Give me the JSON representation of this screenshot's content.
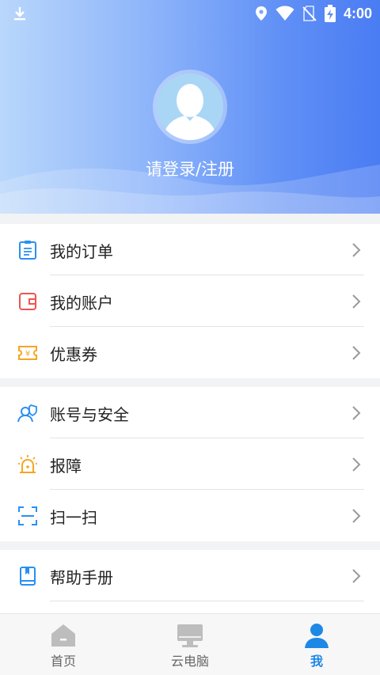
{
  "status_bar": {
    "time": "4:00"
  },
  "profile": {
    "login_label": "请登录/注册"
  },
  "menu_groups": [
    {
      "items": [
        {
          "label": "我的订单",
          "icon": "order-list-icon",
          "color": "#2a8ff2"
        },
        {
          "label": "我的账户",
          "icon": "wallet-icon",
          "color": "#ef5350"
        },
        {
          "label": "优惠券",
          "icon": "coupon-icon",
          "color": "#f5a623"
        }
      ]
    },
    {
      "items": [
        {
          "label": "账号与安全",
          "icon": "account-security-icon",
          "color": "#2a8ff2"
        },
        {
          "label": "报障",
          "icon": "alarm-light-icon",
          "color": "#f5a623"
        },
        {
          "label": "扫一扫",
          "icon": "scan-icon",
          "color": "#2a8ff2"
        }
      ]
    },
    {
      "items": [
        {
          "label": "帮助手册",
          "icon": "help-book-icon",
          "color": "#2a8ff2"
        }
      ]
    }
  ],
  "tabbar": {
    "tabs": [
      {
        "label": "首页",
        "icon": "home-icon",
        "active": false
      },
      {
        "label": "云电脑",
        "icon": "monitor-icon",
        "active": false
      },
      {
        "label": "我",
        "icon": "user-icon",
        "active": true
      }
    ],
    "active_color": "#1e88e5",
    "inactive_color": "#bdbdbd"
  }
}
